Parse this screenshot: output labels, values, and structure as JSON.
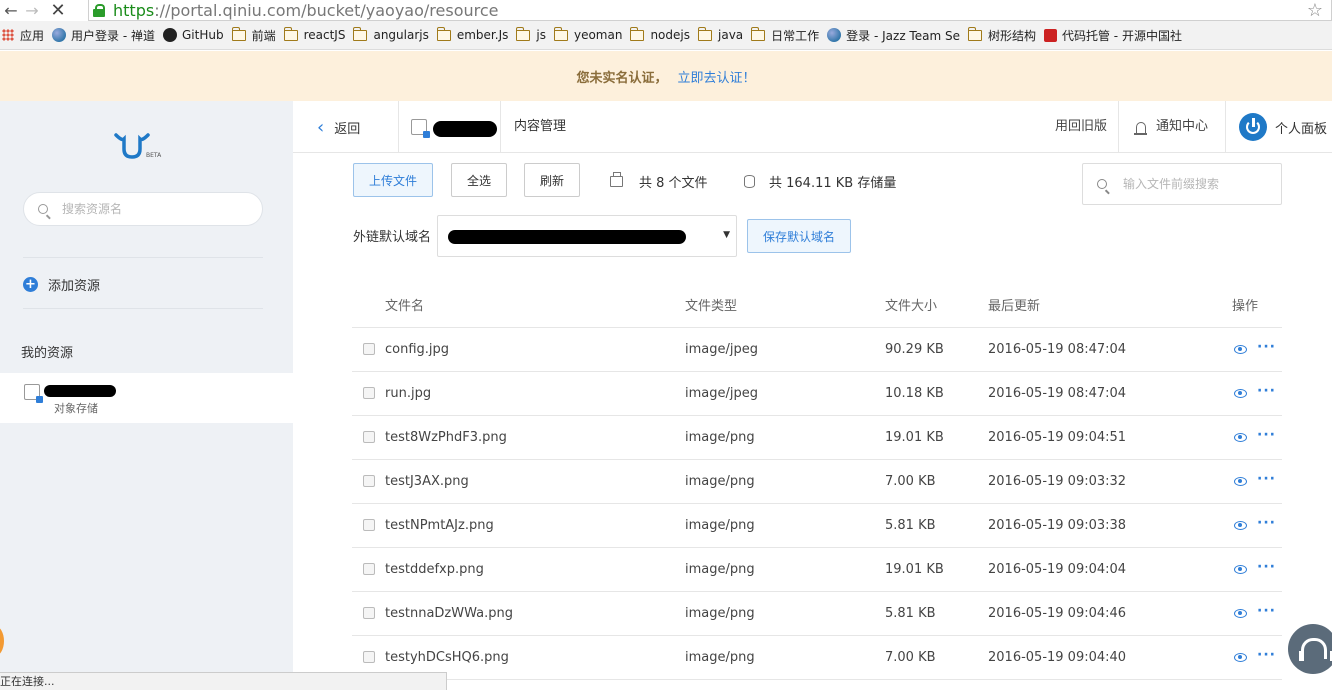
{
  "browser": {
    "url_scheme": "https",
    "url_rest": "://portal.qiniu.com/bucket/yaoyao/resource",
    "bookmarks": [
      "应用",
      "用户登录 - 禅道",
      "GitHub",
      "前端",
      "reactJS",
      "angularjs",
      "ember.Js",
      "js",
      "yeoman",
      "nodejs",
      "java",
      "日常工作",
      "登录 - Jazz Team Se",
      "树形结构",
      "代码托管 - 开源中国社"
    ],
    "status": "正在连接..."
  },
  "notice": {
    "warning": "您未实名认证，",
    "link": "立即去认证！"
  },
  "sidebar": {
    "logo_text": "BETA",
    "search_placeholder": "搜索资源名",
    "add_resource": "添加资源",
    "my_resources": "我的资源",
    "resource_sub": "对象存储"
  },
  "topbar": {
    "back": "返回",
    "content_mgmt": "内容管理",
    "old_version": "用回旧版",
    "notifications": "通知中心",
    "profile": "个人面板"
  },
  "toolbar": {
    "upload": "上传文件",
    "select_all": "全选",
    "refresh": "刷新",
    "file_count": "共 8 个文件",
    "storage": "共 164.11 KB 存储量",
    "search_placeholder": "输入文件前缀搜索",
    "domain_label": "外链默认域名",
    "save_domain": "保存默认域名"
  },
  "table": {
    "headers": {
      "name": "文件名",
      "type": "文件类型",
      "size": "文件大小",
      "date": "最后更新",
      "ops": "操作"
    },
    "rows": [
      {
        "name": "config.jpg",
        "type": "image/jpeg",
        "size": "90.29 KB",
        "date": "2016-05-19 08:47:04"
      },
      {
        "name": "run.jpg",
        "type": "image/jpeg",
        "size": "10.18 KB",
        "date": "2016-05-19 08:47:04"
      },
      {
        "name": "test8WzPhdF3.png",
        "type": "image/png",
        "size": "19.01 KB",
        "date": "2016-05-19 09:04:51"
      },
      {
        "name": "testJ3AX.png",
        "type": "image/png",
        "size": "7.00 KB",
        "date": "2016-05-19 09:03:32"
      },
      {
        "name": "testNPmtAJz.png",
        "type": "image/png",
        "size": "5.81 KB",
        "date": "2016-05-19 09:03:38"
      },
      {
        "name": "testddefxp.png",
        "type": "image/png",
        "size": "19.01 KB",
        "date": "2016-05-19 09:04:04"
      },
      {
        "name": "testnnaDzWWa.png",
        "type": "image/png",
        "size": "5.81 KB",
        "date": "2016-05-19 09:04:46"
      },
      {
        "name": "testyhDCsHQ6.png",
        "type": "image/png",
        "size": "7.00 KB",
        "date": "2016-05-19 09:04:40"
      }
    ]
  },
  "colors": {
    "accent": "#2f7ed8",
    "notice_bg": "#fdf0dc",
    "sidebar_bg": "#eef1f5"
  }
}
